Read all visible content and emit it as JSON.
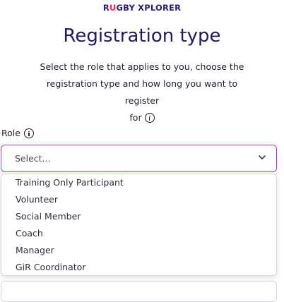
{
  "header": {
    "brand_prefix": "R",
    "brand_accent": "U",
    "brand_suffix": "GBY XPLORER"
  },
  "page": {
    "title": "Registration type",
    "intro_line1": "Select the role that applies to you, choose the",
    "intro_line2": "registration type and how long you want to register",
    "intro_line3": "for",
    "intro_info_icon": "info-icon"
  },
  "role": {
    "label": "Role",
    "info_icon": "info-icon",
    "select_value": "Select...",
    "chevron_icon": "chevron-down-icon",
    "options": [
      "Training Only Participant",
      "Volunteer",
      "Social Member",
      "Coach",
      "Manager",
      "GiR Coordinator"
    ]
  },
  "colors": {
    "brand_navy": "#211a5c",
    "brand_accent": "#e8285a",
    "focus_border": "#a23fbf"
  }
}
